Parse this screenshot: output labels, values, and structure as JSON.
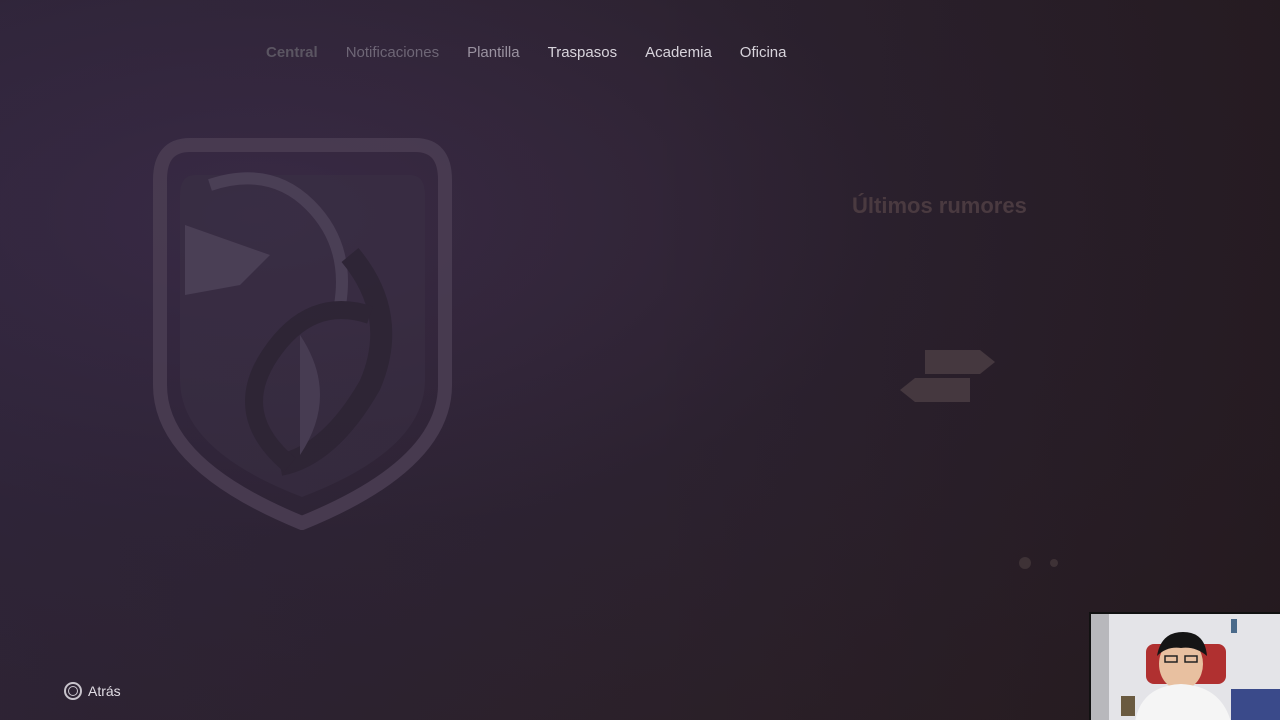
{
  "nav": {
    "tabs": [
      {
        "label": "Central"
      },
      {
        "label": "Notificaciones"
      },
      {
        "label": "Plantilla"
      },
      {
        "label": "Traspasos"
      },
      {
        "label": "Academia"
      },
      {
        "label": "Oficina"
      }
    ]
  },
  "background_text": {
    "ghost_title": "Últimos rumores"
  },
  "footer": {
    "back_label": "Atrás",
    "back_button_icon": "circle-button-icon"
  },
  "colors": {
    "background": "#2c2230",
    "text_light": "#d8d4dc",
    "text_dim": "#6e6676"
  }
}
